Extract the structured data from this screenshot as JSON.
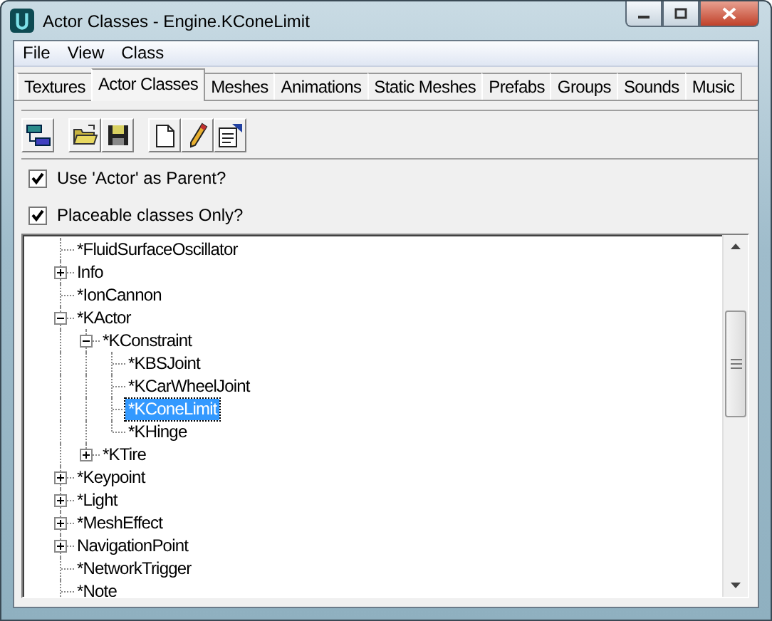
{
  "window": {
    "title": "Actor Classes - Engine.KConeLimit"
  },
  "menu": [
    "File",
    "View",
    "Class"
  ],
  "tabs": [
    {
      "label": "Textures",
      "selected": false
    },
    {
      "label": "Actor Classes",
      "selected": true
    },
    {
      "label": "Meshes",
      "selected": false
    },
    {
      "label": "Animations",
      "selected": false
    },
    {
      "label": "Static Meshes",
      "selected": false
    },
    {
      "label": "Prefabs",
      "selected": false
    },
    {
      "label": "Groups",
      "selected": false
    },
    {
      "label": "Sounds",
      "selected": false
    },
    {
      "label": "Music",
      "selected": false
    }
  ],
  "options": [
    {
      "label": "Use 'Actor' as Parent?",
      "checked": true
    },
    {
      "label": "Placeable classes Only?",
      "checked": true
    }
  ],
  "tree": [
    {
      "label": "*FluidSurfaceOscillator",
      "selected": false
    },
    {
      "label": "Info",
      "selected": false,
      "expanded": false
    },
    {
      "label": "*IonCannon",
      "selected": false
    },
    {
      "label": "*KActor",
      "selected": false,
      "expanded": true,
      "children": [
        {
          "label": "*KConstraint",
          "selected": false,
          "expanded": true,
          "children": [
            {
              "label": "*KBSJoint",
              "selected": false
            },
            {
              "label": "*KCarWheelJoint",
              "selected": false
            },
            {
              "label": "*KConeLimit",
              "selected": true
            },
            {
              "label": "*KHinge",
              "selected": false
            }
          ]
        },
        {
          "label": "*KTire",
          "selected": false,
          "expanded": false
        }
      ]
    },
    {
      "label": "*Keypoint",
      "selected": false,
      "expanded": false
    },
    {
      "label": "*Light",
      "selected": false,
      "expanded": false
    },
    {
      "label": "*MeshEffect",
      "selected": false,
      "expanded": false
    },
    {
      "label": "NavigationPoint",
      "selected": false,
      "expanded": false
    },
    {
      "label": "*NetworkTrigger",
      "selected": false
    },
    {
      "label": "*Note",
      "selected": false
    }
  ]
}
